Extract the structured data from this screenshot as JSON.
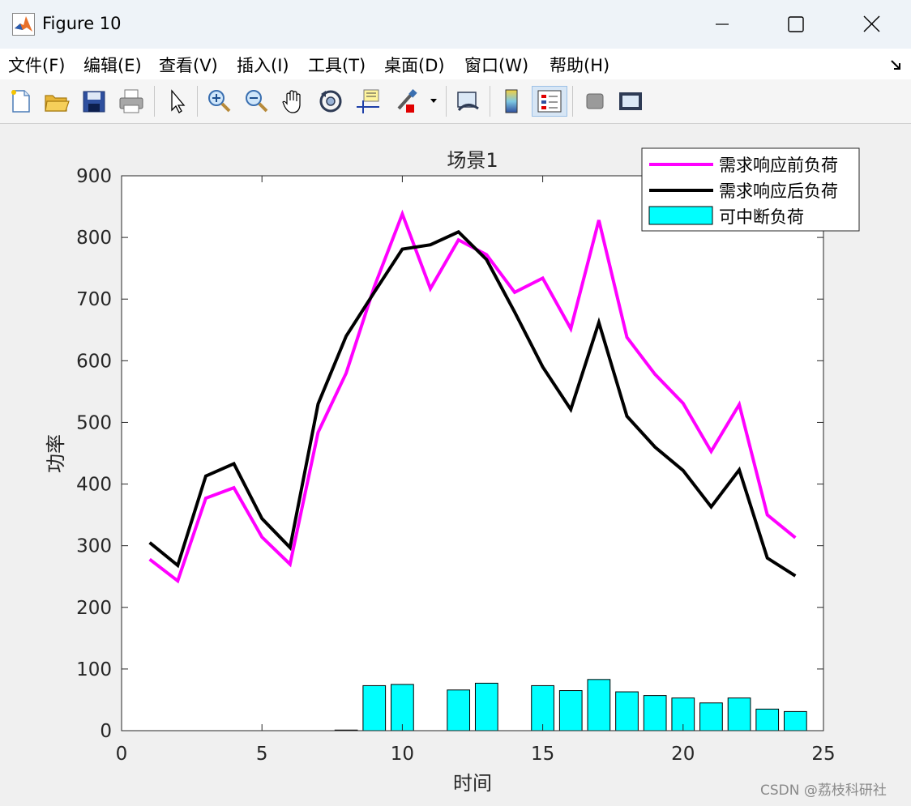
{
  "window": {
    "title": "Figure 10"
  },
  "menu": {
    "items": [
      {
        "label": "文件(F)"
      },
      {
        "label": "编辑(E)"
      },
      {
        "label": "查看(V)"
      },
      {
        "label": "插入(I)"
      },
      {
        "label": "工具(T)"
      },
      {
        "label": "桌面(D)"
      },
      {
        "label": "窗口(W)"
      },
      {
        "label": "帮助(H)"
      }
    ]
  },
  "toolbar": {
    "icons": [
      "new-figure-icon",
      "open-file-icon",
      "save-icon",
      "print-icon",
      "pointer-icon",
      "zoom-in-icon",
      "zoom-out-icon",
      "pan-hand-icon",
      "rotate-3d-icon",
      "data-cursor-icon",
      "brush-icon",
      "link-plot-icon",
      "colorbar-icon",
      "legend-icon",
      "hide-plot-tools-icon",
      "show-plot-tools-icon"
    ]
  },
  "watermark": "CSDN @荔枝科研社",
  "colors": {
    "before": "#ff00ff",
    "after": "#000000",
    "bars": "#00ffff"
  },
  "chart_data": {
    "type": "line",
    "title": "场景1",
    "xlabel": "时间",
    "ylabel": "功率",
    "xlim": [
      0,
      25
    ],
    "ylim": [
      0,
      900
    ],
    "xticks": [
      0,
      5,
      10,
      15,
      20,
      25
    ],
    "yticks": [
      0,
      100,
      200,
      300,
      400,
      500,
      600,
      700,
      800,
      900
    ],
    "grid": false,
    "legend_position": "top-right",
    "x": [
      1,
      2,
      3,
      4,
      5,
      6,
      7,
      8,
      9,
      10,
      11,
      12,
      13,
      14,
      15,
      16,
      17,
      18,
      19,
      20,
      21,
      22,
      23,
      24
    ],
    "series": [
      {
        "name": "需求响应前负荷",
        "kind": "line",
        "color": "#ff00ff",
        "values": [
          278,
          243,
          377,
          394,
          314,
          270,
          484,
          580,
          720,
          838,
          717,
          796,
          772,
          711,
          734,
          652,
          828,
          638,
          578,
          531,
          453,
          529,
          350,
          313
        ]
      },
      {
        "name": "需求响应后负荷",
        "kind": "line",
        "color": "#000000",
        "values": [
          305,
          268,
          413,
          433,
          344,
          297,
          530,
          640,
          711,
          781,
          788,
          809,
          764,
          679,
          590,
          521,
          662,
          510,
          460,
          422,
          363,
          423,
          280,
          251
        ]
      },
      {
        "name": "可中断负荷",
        "kind": "bar",
        "color": "#00ffff",
        "values": [
          0,
          0,
          0,
          0,
          0,
          0,
          0,
          1,
          73,
          75,
          0,
          66,
          77,
          0,
          73,
          65,
          83,
          63,
          57,
          53,
          45,
          53,
          35,
          31
        ]
      }
    ]
  }
}
